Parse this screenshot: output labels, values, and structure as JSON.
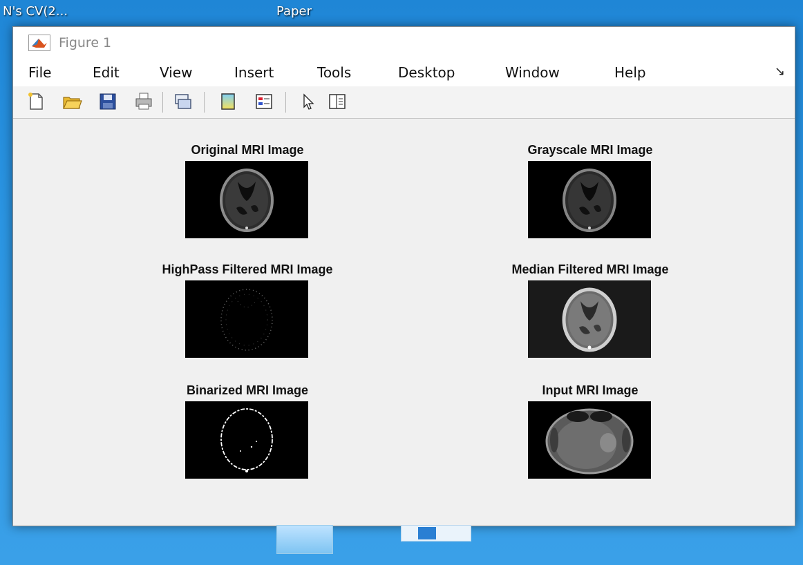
{
  "desktop": {
    "top_labels": [
      "N's CV(2...",
      "Paper"
    ]
  },
  "window": {
    "title": "Figure 1",
    "menu": [
      "File",
      "Edit",
      "View",
      "Insert",
      "Tools",
      "Desktop",
      "Window",
      "Help"
    ],
    "menu_overflow": "↘",
    "toolbar": [
      "new-figure-icon",
      "open-file-icon",
      "save-icon",
      "print-icon",
      "link-plot-icon",
      "insert-colorbar-icon",
      "insert-legend-icon",
      "edit-plot-icon",
      "property-editor-icon"
    ]
  },
  "figure": {
    "panels": [
      {
        "title": "Original MRI Image",
        "kind": "original"
      },
      {
        "title": "Grayscale MRI Image",
        "kind": "gray"
      },
      {
        "title": "HighPass Filtered MRI Image",
        "kind": "highpass"
      },
      {
        "title": "Median Filtered MRI Image",
        "kind": "median"
      },
      {
        "title": "Binarized MRI Image",
        "kind": "binary"
      },
      {
        "title": "Input MRI Image",
        "kind": "input"
      }
    ]
  },
  "colors": {
    "desktop": "#2b95e2",
    "window_bg": "#f0f0f0",
    "matlab_icon": "#d9531e"
  }
}
